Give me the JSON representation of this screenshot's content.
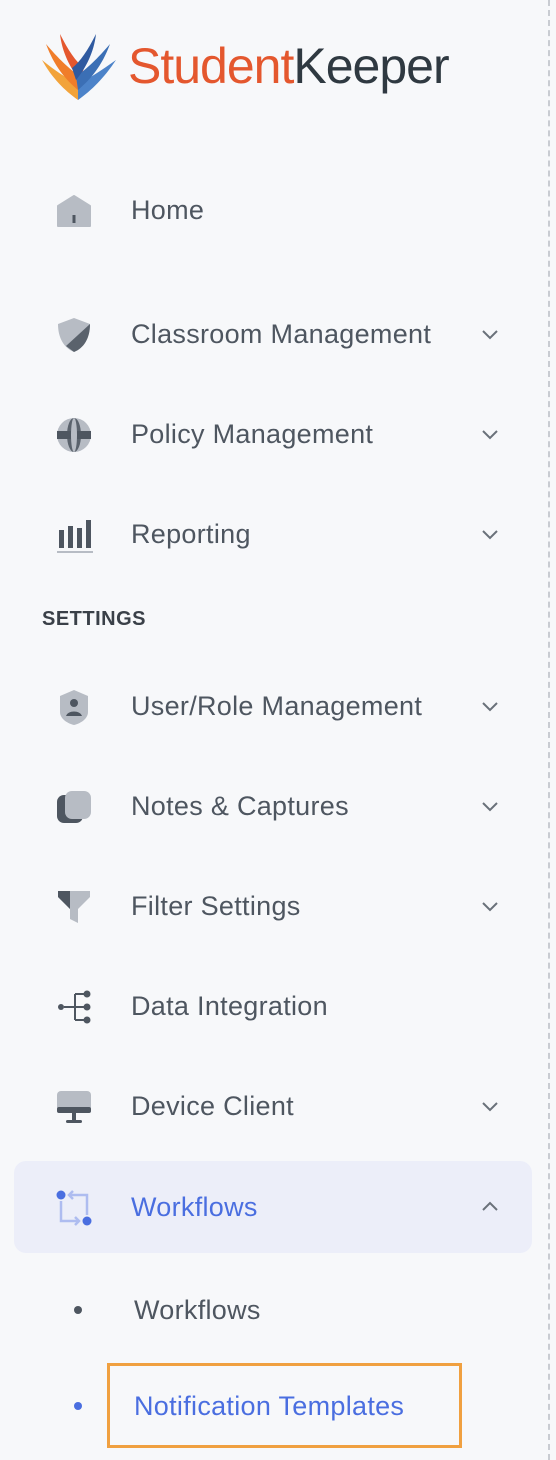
{
  "logo": {
    "part1": "Student",
    "part2": "Keeper"
  },
  "nav": {
    "home": "Home",
    "classroom": "Classroom Management",
    "policy": "Policy Management",
    "reporting": "Reporting"
  },
  "settings_heading": "SETTINGS",
  "settings": {
    "user_role": "User/Role Management",
    "notes": "Notes & Captures",
    "filter": "Filter Settings",
    "data_integration": "Data Integration",
    "device_client": "Device Client",
    "workflows": "Workflows"
  },
  "workflows_sub": {
    "workflows": "Workflows",
    "notification_templates": "Notification Templates"
  },
  "colors": {
    "accent": "#4a6ee0",
    "brand_orange": "#e4572e",
    "highlight": "#f0a040"
  }
}
